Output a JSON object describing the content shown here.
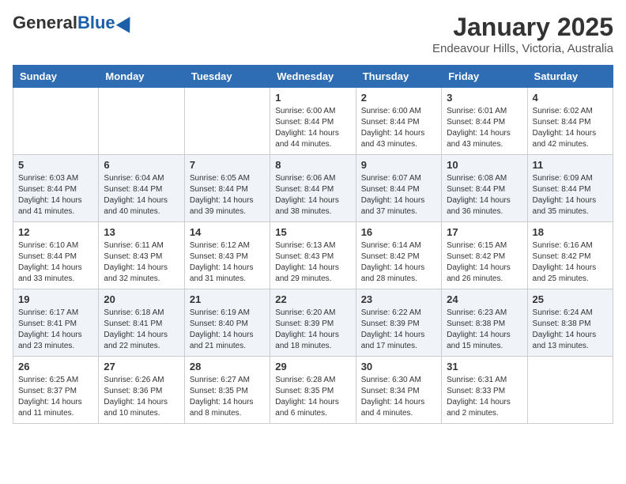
{
  "header": {
    "logo_general": "General",
    "logo_blue": "Blue",
    "month_title": "January 2025",
    "location": "Endeavour Hills, Victoria, Australia"
  },
  "weekdays": [
    "Sunday",
    "Monday",
    "Tuesday",
    "Wednesday",
    "Thursday",
    "Friday",
    "Saturday"
  ],
  "weeks": [
    [
      {
        "day": "",
        "sunrise": "",
        "sunset": "",
        "daylight": "",
        "empty": true
      },
      {
        "day": "",
        "sunrise": "",
        "sunset": "",
        "daylight": "",
        "empty": true
      },
      {
        "day": "",
        "sunrise": "",
        "sunset": "",
        "daylight": "",
        "empty": true
      },
      {
        "day": "1",
        "sunrise": "Sunrise: 6:00 AM",
        "sunset": "Sunset: 8:44 PM",
        "daylight": "Daylight: 14 hours and 44 minutes."
      },
      {
        "day": "2",
        "sunrise": "Sunrise: 6:00 AM",
        "sunset": "Sunset: 8:44 PM",
        "daylight": "Daylight: 14 hours and 43 minutes."
      },
      {
        "day": "3",
        "sunrise": "Sunrise: 6:01 AM",
        "sunset": "Sunset: 8:44 PM",
        "daylight": "Daylight: 14 hours and 43 minutes."
      },
      {
        "day": "4",
        "sunrise": "Sunrise: 6:02 AM",
        "sunset": "Sunset: 8:44 PM",
        "daylight": "Daylight: 14 hours and 42 minutes."
      }
    ],
    [
      {
        "day": "5",
        "sunrise": "Sunrise: 6:03 AM",
        "sunset": "Sunset: 8:44 PM",
        "daylight": "Daylight: 14 hours and 41 minutes."
      },
      {
        "day": "6",
        "sunrise": "Sunrise: 6:04 AM",
        "sunset": "Sunset: 8:44 PM",
        "daylight": "Daylight: 14 hours and 40 minutes."
      },
      {
        "day": "7",
        "sunrise": "Sunrise: 6:05 AM",
        "sunset": "Sunset: 8:44 PM",
        "daylight": "Daylight: 14 hours and 39 minutes."
      },
      {
        "day": "8",
        "sunrise": "Sunrise: 6:06 AM",
        "sunset": "Sunset: 8:44 PM",
        "daylight": "Daylight: 14 hours and 38 minutes."
      },
      {
        "day": "9",
        "sunrise": "Sunrise: 6:07 AM",
        "sunset": "Sunset: 8:44 PM",
        "daylight": "Daylight: 14 hours and 37 minutes."
      },
      {
        "day": "10",
        "sunrise": "Sunrise: 6:08 AM",
        "sunset": "Sunset: 8:44 PM",
        "daylight": "Daylight: 14 hours and 36 minutes."
      },
      {
        "day": "11",
        "sunrise": "Sunrise: 6:09 AM",
        "sunset": "Sunset: 8:44 PM",
        "daylight": "Daylight: 14 hours and 35 minutes."
      }
    ],
    [
      {
        "day": "12",
        "sunrise": "Sunrise: 6:10 AM",
        "sunset": "Sunset: 8:44 PM",
        "daylight": "Daylight: 14 hours and 33 minutes."
      },
      {
        "day": "13",
        "sunrise": "Sunrise: 6:11 AM",
        "sunset": "Sunset: 8:43 PM",
        "daylight": "Daylight: 14 hours and 32 minutes."
      },
      {
        "day": "14",
        "sunrise": "Sunrise: 6:12 AM",
        "sunset": "Sunset: 8:43 PM",
        "daylight": "Daylight: 14 hours and 31 minutes."
      },
      {
        "day": "15",
        "sunrise": "Sunrise: 6:13 AM",
        "sunset": "Sunset: 8:43 PM",
        "daylight": "Daylight: 14 hours and 29 minutes."
      },
      {
        "day": "16",
        "sunrise": "Sunrise: 6:14 AM",
        "sunset": "Sunset: 8:42 PM",
        "daylight": "Daylight: 14 hours and 28 minutes."
      },
      {
        "day": "17",
        "sunrise": "Sunrise: 6:15 AM",
        "sunset": "Sunset: 8:42 PM",
        "daylight": "Daylight: 14 hours and 26 minutes."
      },
      {
        "day": "18",
        "sunrise": "Sunrise: 6:16 AM",
        "sunset": "Sunset: 8:42 PM",
        "daylight": "Daylight: 14 hours and 25 minutes."
      }
    ],
    [
      {
        "day": "19",
        "sunrise": "Sunrise: 6:17 AM",
        "sunset": "Sunset: 8:41 PM",
        "daylight": "Daylight: 14 hours and 23 minutes."
      },
      {
        "day": "20",
        "sunrise": "Sunrise: 6:18 AM",
        "sunset": "Sunset: 8:41 PM",
        "daylight": "Daylight: 14 hours and 22 minutes."
      },
      {
        "day": "21",
        "sunrise": "Sunrise: 6:19 AM",
        "sunset": "Sunset: 8:40 PM",
        "daylight": "Daylight: 14 hours and 21 minutes."
      },
      {
        "day": "22",
        "sunrise": "Sunrise: 6:20 AM",
        "sunset": "Sunset: 8:39 PM",
        "daylight": "Daylight: 14 hours and 18 minutes."
      },
      {
        "day": "23",
        "sunrise": "Sunrise: 6:22 AM",
        "sunset": "Sunset: 8:39 PM",
        "daylight": "Daylight: 14 hours and 17 minutes."
      },
      {
        "day": "24",
        "sunrise": "Sunrise: 6:23 AM",
        "sunset": "Sunset: 8:38 PM",
        "daylight": "Daylight: 14 hours and 15 minutes."
      },
      {
        "day": "25",
        "sunrise": "Sunrise: 6:24 AM",
        "sunset": "Sunset: 8:38 PM",
        "daylight": "Daylight: 14 hours and 13 minutes."
      }
    ],
    [
      {
        "day": "26",
        "sunrise": "Sunrise: 6:25 AM",
        "sunset": "Sunset: 8:37 PM",
        "daylight": "Daylight: 14 hours and 11 minutes."
      },
      {
        "day": "27",
        "sunrise": "Sunrise: 6:26 AM",
        "sunset": "Sunset: 8:36 PM",
        "daylight": "Daylight: 14 hours and 10 minutes."
      },
      {
        "day": "28",
        "sunrise": "Sunrise: 6:27 AM",
        "sunset": "Sunset: 8:35 PM",
        "daylight": "Daylight: 14 hours and 8 minutes."
      },
      {
        "day": "29",
        "sunrise": "Sunrise: 6:28 AM",
        "sunset": "Sunset: 8:35 PM",
        "daylight": "Daylight: 14 hours and 6 minutes."
      },
      {
        "day": "30",
        "sunrise": "Sunrise: 6:30 AM",
        "sunset": "Sunset: 8:34 PM",
        "daylight": "Daylight: 14 hours and 4 minutes."
      },
      {
        "day": "31",
        "sunrise": "Sunrise: 6:31 AM",
        "sunset": "Sunset: 8:33 PM",
        "daylight": "Daylight: 14 hours and 2 minutes."
      },
      {
        "day": "",
        "sunrise": "",
        "sunset": "",
        "daylight": "",
        "empty": true
      }
    ]
  ]
}
